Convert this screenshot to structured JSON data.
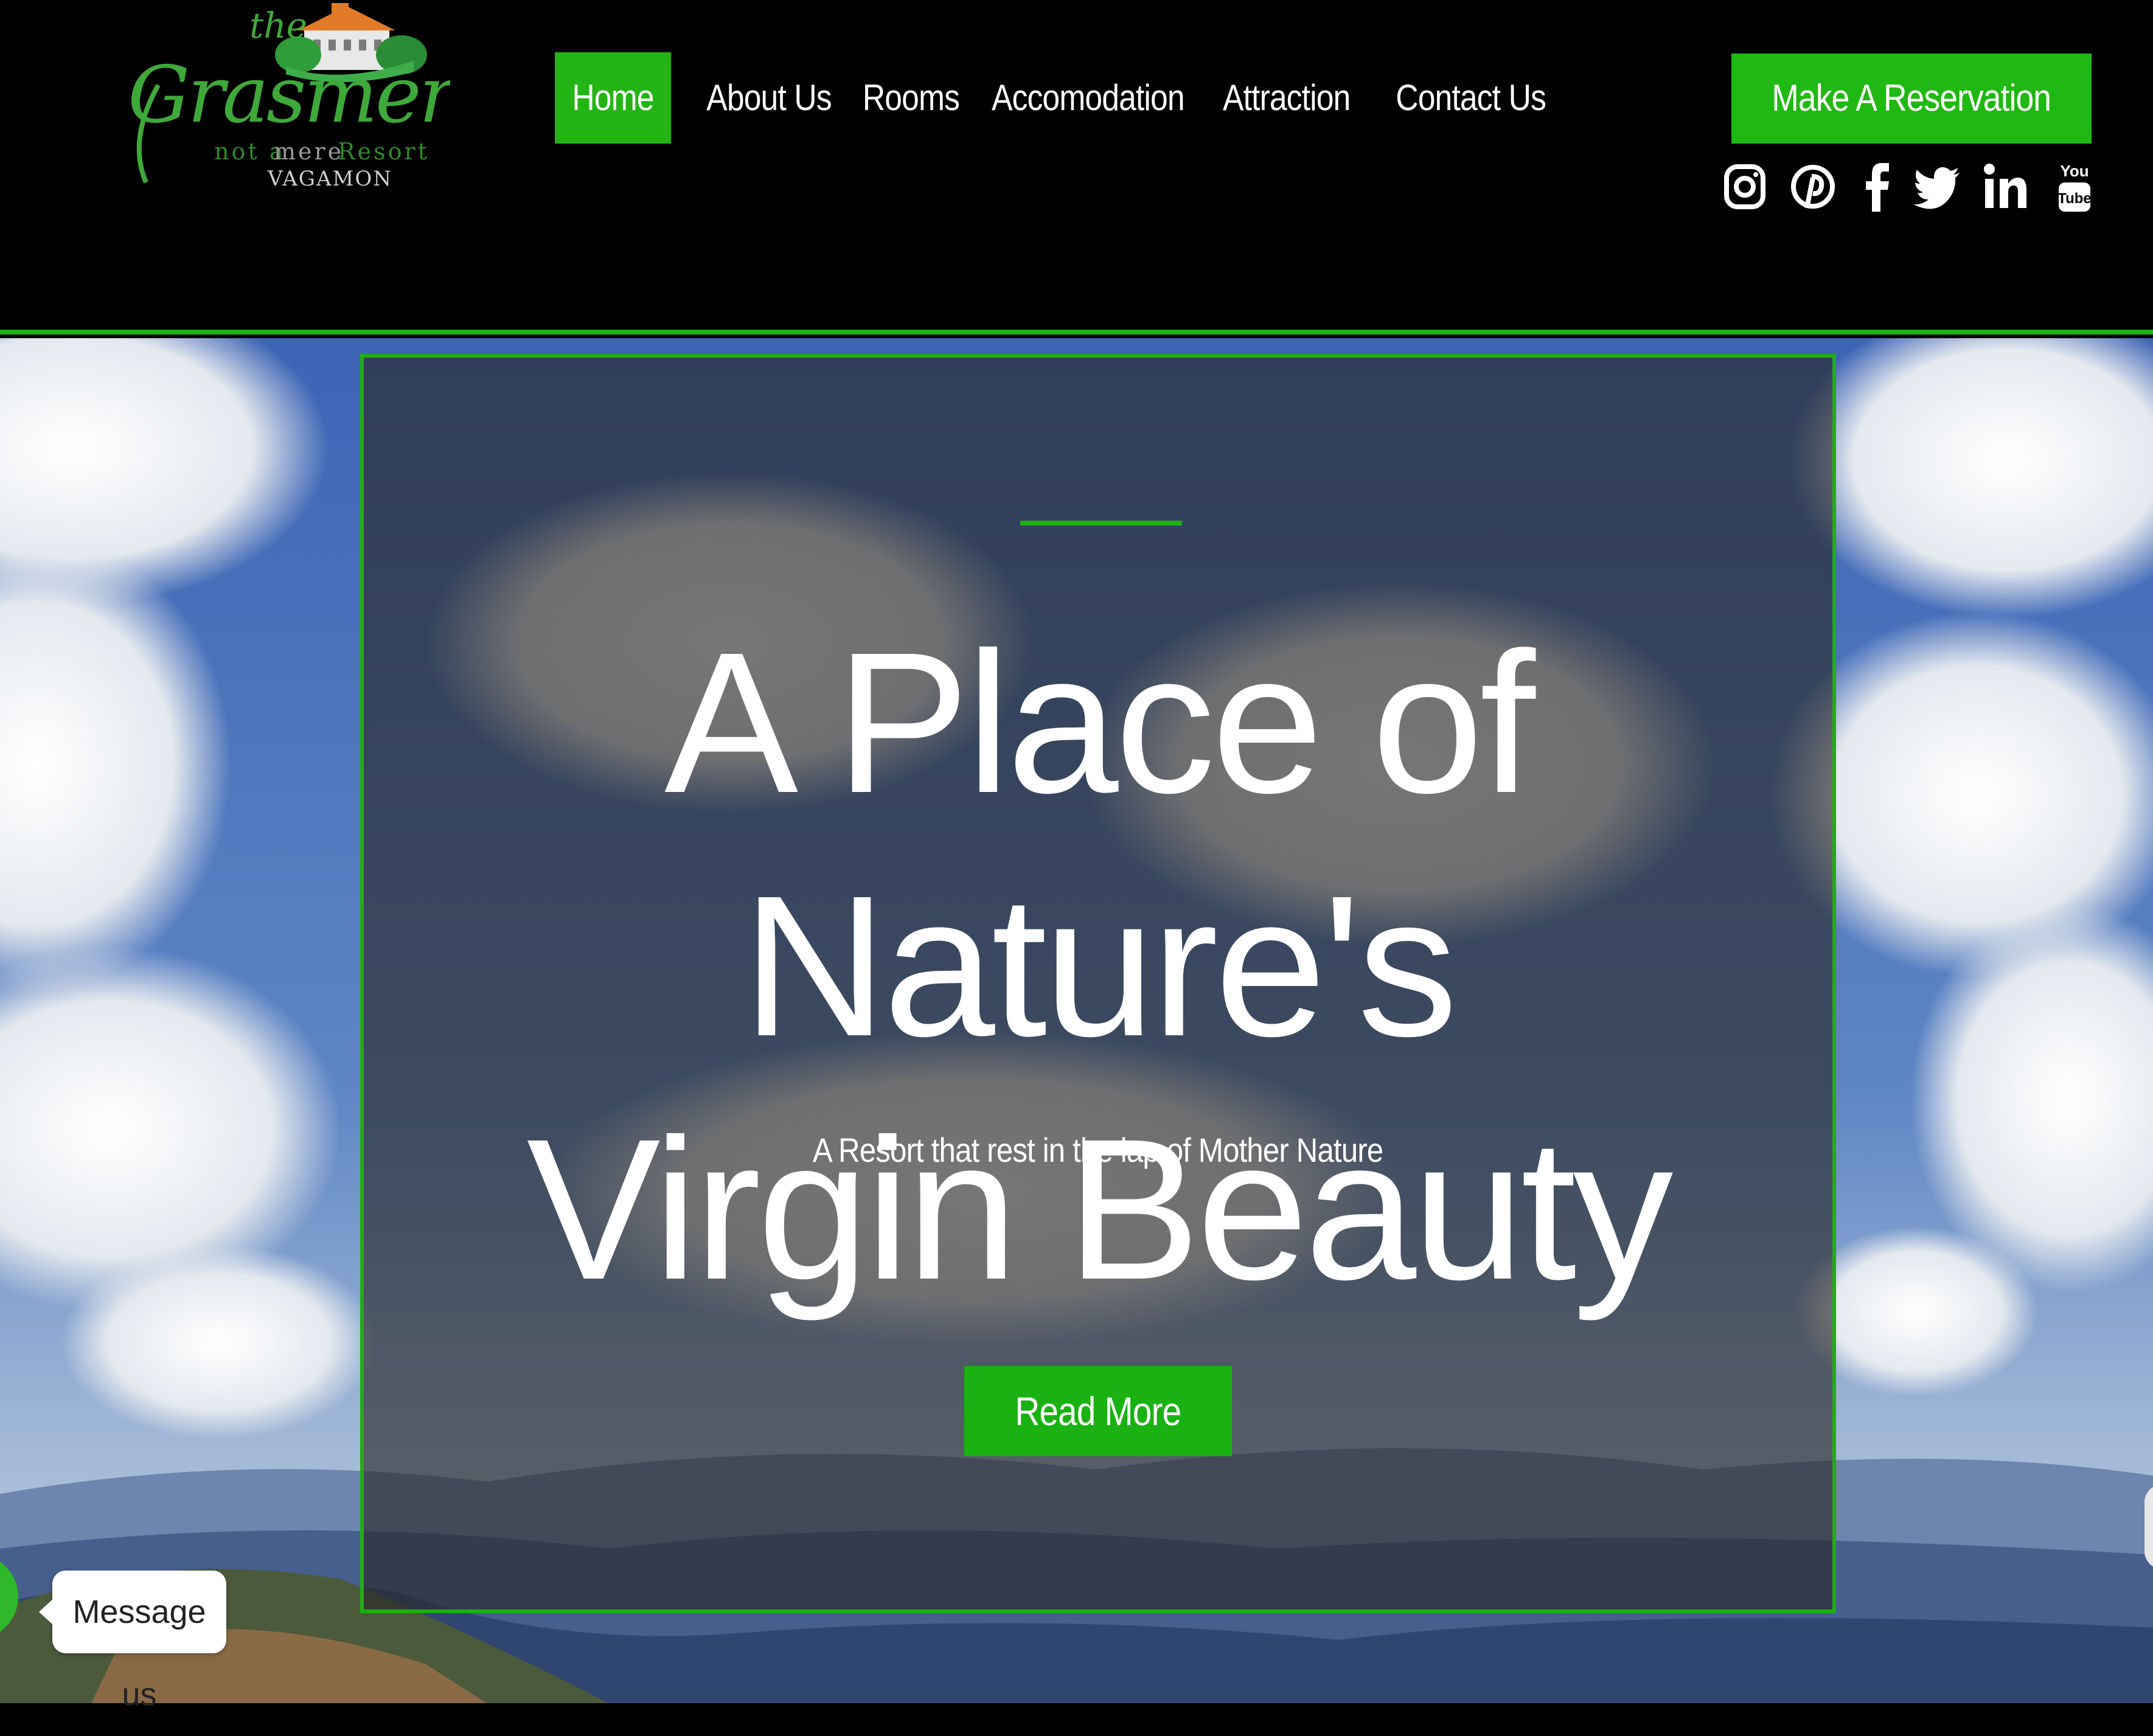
{
  "logo": {
    "line1": "the",
    "line2": "Grasmere",
    "tagline_a": "not a",
    "tagline_b": "mere",
    "tagline_c": "Resort",
    "place": "VAGAMON"
  },
  "nav": {
    "items": [
      {
        "label": "Home",
        "active": true
      },
      {
        "label": "About Us"
      },
      {
        "label": "Rooms"
      },
      {
        "label": "Accomodation"
      },
      {
        "label": "Attraction"
      },
      {
        "label": "Contact Us"
      }
    ]
  },
  "header": {
    "reserve_label": "Make A Reservation",
    "social": [
      "instagram-icon",
      "pinterest-icon",
      "facebook-icon",
      "twitter-icon",
      "linkedin-icon",
      "youtube-icon"
    ]
  },
  "hero": {
    "title_line1": "A Place of Nature's",
    "title_line2": "Virgin Beauty",
    "subtitle": "A Resort that rest in the lap of Mother Nature",
    "cta_label": "Read More"
  },
  "chat": {
    "label": "Message us"
  },
  "colors": {
    "accent": "#1fae14",
    "header_bg": "#000000",
    "text": "#ffffff"
  }
}
